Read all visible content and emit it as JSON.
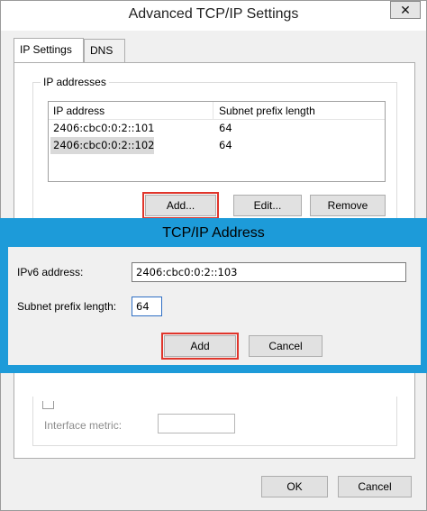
{
  "parent_dialog": {
    "title": "Advanced TCP/IP Settings",
    "close_glyph": "✕",
    "tabs": [
      {
        "label": "IP Settings",
        "active": true
      },
      {
        "label": "DNS",
        "active": false
      }
    ],
    "ip_addresses_group": {
      "label": "IP addresses",
      "columns": [
        "IP address",
        "Subnet prefix length"
      ],
      "rows": [
        {
          "ip": "2406:cbc0:0:2::101",
          "prefix": "64"
        },
        {
          "ip": "2406:cbc0:0:2::102",
          "prefix": "64"
        }
      ],
      "buttons": {
        "add": "Add...",
        "edit": "Edit...",
        "remove": "Remove"
      }
    },
    "interface_metric_label": "Interface metric:",
    "interface_metric_value": "",
    "footer_buttons": {
      "ok": "OK",
      "cancel": "Cancel"
    }
  },
  "overlay_dialog": {
    "title": "TCP/IP Address",
    "ipv6_label": "IPv6 address:",
    "ipv6_value": "2406:cbc0:0:2::103",
    "prefix_label": "Subnet prefix length:",
    "prefix_value": "64",
    "buttons": {
      "add": "Add",
      "cancel": "Cancel"
    }
  },
  "colors": {
    "highlight_outline": "#e0352b",
    "overlay_frame": "#1d9bd9"
  }
}
